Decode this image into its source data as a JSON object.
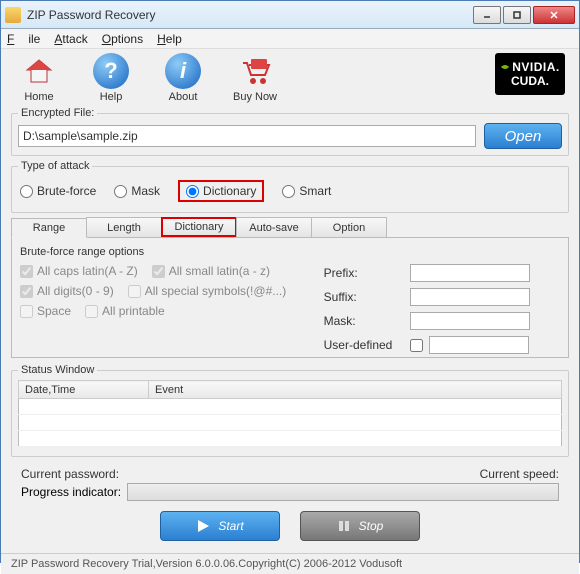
{
  "window": {
    "title": "ZIP Password Recovery"
  },
  "menu": {
    "file": "File",
    "attack": "Attack",
    "options": "Options",
    "help": "Help"
  },
  "toolbar": {
    "home": "Home",
    "help": "Help",
    "about": "About",
    "buynow": "Buy Now",
    "cuda_brand": "NVIDIA.",
    "cuda_name": "CUDA."
  },
  "file": {
    "legend": "Encrypted File:",
    "path": "D:\\sample\\sample.zip",
    "open": "Open"
  },
  "attack": {
    "legend": "Type of attack",
    "brute": "Brute-force",
    "mask": "Mask",
    "dict": "Dictionary",
    "smart": "Smart",
    "selected": "dict"
  },
  "tabs": {
    "range": "Range",
    "length": "Length",
    "dictionary": "Dictionary",
    "autosave": "Auto-save",
    "option": "Option"
  },
  "range": {
    "legend": "Brute-force range options",
    "caps": "All caps latin(A - Z)",
    "small": "All small latin(a - z)",
    "digits": "All digits(0 - 9)",
    "special": "All special symbols(!@#...)",
    "space": "Space",
    "printable": "All printable",
    "prefix": "Prefix:",
    "suffix": "Suffix:",
    "maskl": "Mask:",
    "userdef": "User-defined"
  },
  "status": {
    "legend": "Status Window",
    "col_date": "Date,Time",
    "col_event": "Event"
  },
  "progress": {
    "cur_pwd": "Current password:",
    "cur_speed": "Current speed:",
    "indicator": "Progress indicator:"
  },
  "actions": {
    "start": "Start",
    "stop": "Stop"
  },
  "footer": "ZIP Password Recovery Trial,Version 6.0.0.06.Copyright(C) 2006-2012 Vodusoft"
}
